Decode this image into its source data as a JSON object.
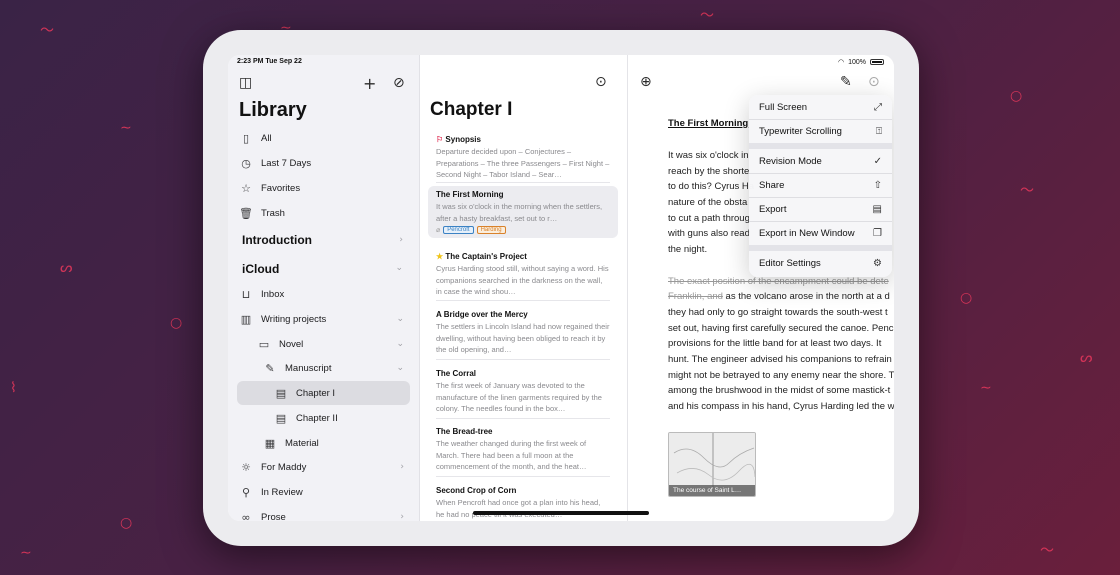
{
  "status": {
    "time": "2:23 PM  Tue Sep 22",
    "battery": "100%"
  },
  "sidebar": {
    "title": "Library",
    "items": [
      {
        "label": "All",
        "icon": "book-icon"
      },
      {
        "label": "Last 7 Days",
        "icon": "clock-icon"
      },
      {
        "label": "Favorites",
        "icon": "star-icon"
      },
      {
        "label": "Trash",
        "icon": "trash-icon"
      }
    ],
    "sections": {
      "introduction": "Introduction",
      "icloud": "iCloud"
    },
    "tree": [
      {
        "label": "Inbox",
        "icon": "inbox-icon"
      },
      {
        "label": "Writing projects",
        "icon": "books-icon"
      },
      {
        "label": "Novel",
        "icon": "box-icon"
      },
      {
        "label": "Manuscript",
        "icon": "pen-icon"
      },
      {
        "label": "Chapter I",
        "icon": "document-icon"
      },
      {
        "label": "Chapter II",
        "icon": "document-icon"
      },
      {
        "label": "Material",
        "icon": "clipboard-icon"
      },
      {
        "label": "For Maddy",
        "icon": "sun-icon"
      },
      {
        "label": "In Review",
        "icon": "magnifier-icon"
      },
      {
        "label": "Prose",
        "icon": "glasses-icon"
      }
    ]
  },
  "sheets": {
    "title": "Chapter I",
    "items": [
      {
        "title": "Synopsis",
        "text": "Departure decided upon – Conjectures – Preparations – The three Passengers – First Night – Second Night – Tabor Island – Sear…"
      },
      {
        "title": "The First Morning",
        "text": "It was six o'clock in the morning when the settlers, after a hasty breakfast, set out to r…",
        "tags": [
          "Pencroft",
          "Harding"
        ]
      },
      {
        "title": "The Captain's Project",
        "text": "Cyrus Harding stood still, without saying a word. His companions searched in the darkness on the wall, in case the wind shou…"
      },
      {
        "title": "A Bridge over the Mercy",
        "text": "The settlers in Lincoln Island had now regained their dwelling, without having been obliged to reach it by the old opening, and…"
      },
      {
        "title": "The Corral",
        "text": "The first week of January was devoted to the manufacture of the linen garments required by the colony. The needles found in the box…"
      },
      {
        "title": "The Bread-tree",
        "text": "The weather changed during the first week of March. There had been a full moon at the commencement of the month, and the heat…"
      },
      {
        "title": "Second Crop of Corn",
        "text": "When Pencroft had once got a plan into his head, he had no peace till it was executed…"
      }
    ]
  },
  "editor": {
    "heading": "The First Morning",
    "para1": [
      "It was six o'clock in",
      "reach by the shorte",
      "to do this? Cyrus Ha",
      "nature of the obsta",
      "to cut a path throug",
      "with guns also read",
      "the night."
    ],
    "strike1": "The exact position of the encampment could be dete",
    "strike2": "Franklin, and",
    "para2_first": " as the volcano arose in the north at a d",
    "para2": [
      "they had only to go straight towards the south-west t",
      "set out, having first carefully secured the canoe. Penc",
      "provisions for the little band for at least two days. It",
      "hunt. The engineer advised his companions to refrain",
      "might not be betrayed to any enemy near the shore. The",
      "among the brushwood in the midst of some mastick-t",
      "and his compass in his hand, Cyrus Harding led the w"
    ],
    "image_caption": "The course of Saint L…"
  },
  "menu": {
    "items": [
      {
        "label": "Full Screen",
        "icon": "expand-icon"
      },
      {
        "label": "Typewriter Scrolling",
        "icon": "typewriter-icon"
      },
      {
        "label": "Revision Mode",
        "icon": "checkmark-circle-icon"
      },
      {
        "label": "Share",
        "icon": "share-icon"
      },
      {
        "label": "Export",
        "icon": "export-icon"
      },
      {
        "label": "Export in New Window",
        "icon": "new-window-icon"
      },
      {
        "label": "Editor Settings",
        "icon": "settings-icon"
      }
    ]
  },
  "colors": {
    "accent": "#e0365a",
    "tag_blue": "#3b82c4",
    "tag_orange": "#d9822b"
  }
}
